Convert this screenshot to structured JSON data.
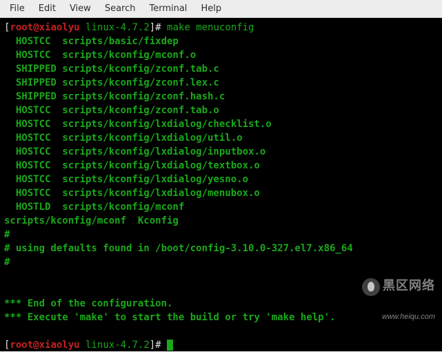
{
  "menubar": {
    "file": "File",
    "edit": "Edit",
    "view": "View",
    "search": "Search",
    "terminal": "Terminal",
    "help": "Help"
  },
  "terminal": {
    "prompt_open": "[",
    "prompt_user": "root@xiaolyu",
    "prompt_space": " ",
    "prompt_dir": "linux-4.7.2",
    "prompt_close": "]# ",
    "command": "make menuconfig",
    "lines": {
      "l1": "  HOSTCC  scripts/basic/fixdep",
      "l2": "  HOSTCC  scripts/kconfig/mconf.o",
      "l3": "  SHIPPED scripts/kconfig/zconf.tab.c",
      "l4": "  SHIPPED scripts/kconfig/zconf.lex.c",
      "l5": "  SHIPPED scripts/kconfig/zconf.hash.c",
      "l6": "  HOSTCC  scripts/kconfig/zconf.tab.o",
      "l7": "  HOSTCC  scripts/kconfig/lxdialog/checklist.o",
      "l8": "  HOSTCC  scripts/kconfig/lxdialog/util.o",
      "l9": "  HOSTCC  scripts/kconfig/lxdialog/inputbox.o",
      "l10": "  HOSTCC  scripts/kconfig/lxdialog/textbox.o",
      "l11": "  HOSTCC  scripts/kconfig/lxdialog/yesno.o",
      "l12": "  HOSTCC  scripts/kconfig/lxdialog/menubox.o",
      "l13": "  HOSTLD  scripts/kconfig/mconf",
      "l14": "scripts/kconfig/mconf  Kconfig",
      "l15": "#",
      "l16": "# using defaults found in /boot/config-3.10.0-327.el7.x86_64",
      "l17": "#",
      "l18": "",
      "l19": "",
      "l20": "*** End of the configuration.",
      "l21": "*** Execute 'make' to start the build or try 'make help'."
    }
  },
  "watermark": {
    "main": "黑区网络",
    "url": "www.heiqu.com"
  }
}
